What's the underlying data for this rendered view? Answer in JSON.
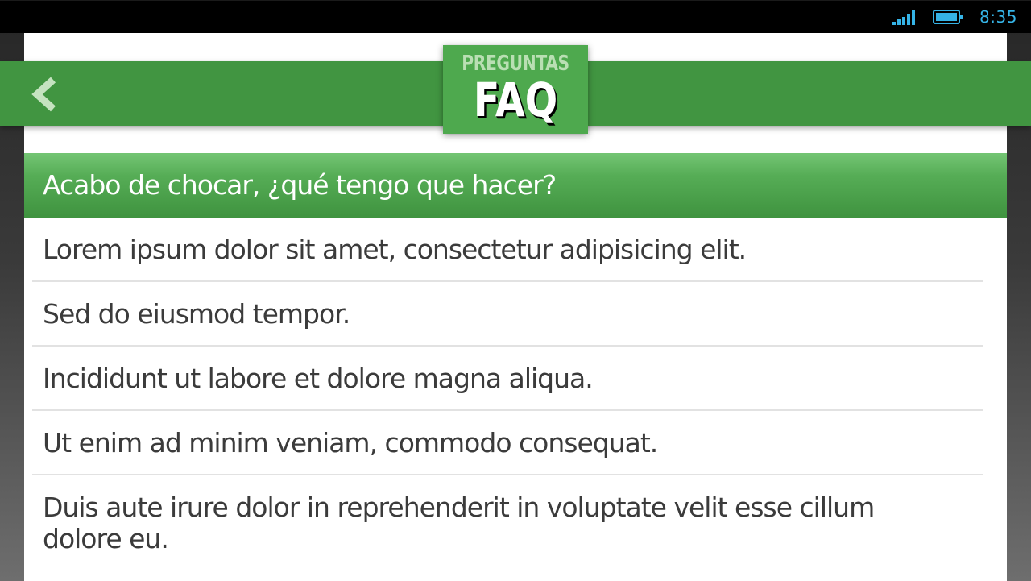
{
  "status_bar": {
    "time": "8:35",
    "icons": [
      "signal-icon",
      "battery-icon"
    ],
    "accent_color": "#35b3e6"
  },
  "header": {
    "badge_top": "PREGUNTAS",
    "badge_main": "FAQ",
    "back_icon": "chevron-left-icon",
    "bar_color": "#419541",
    "badge_color": "#4ea94e"
  },
  "faq": {
    "question": "Acabo de chocar, ¿qué tengo que hacer?",
    "items": [
      "Lorem ipsum dolor sit amet, consectetur adipisicing elit.",
      "Sed do eiusmod tempor.",
      "Incididunt ut labore et dolore magna aliqua.",
      "Ut enim ad minim veniam, commodo consequat.",
      "Duis aute irure dolor in reprehenderit in voluptate velit esse cillum dolore eu."
    ]
  }
}
